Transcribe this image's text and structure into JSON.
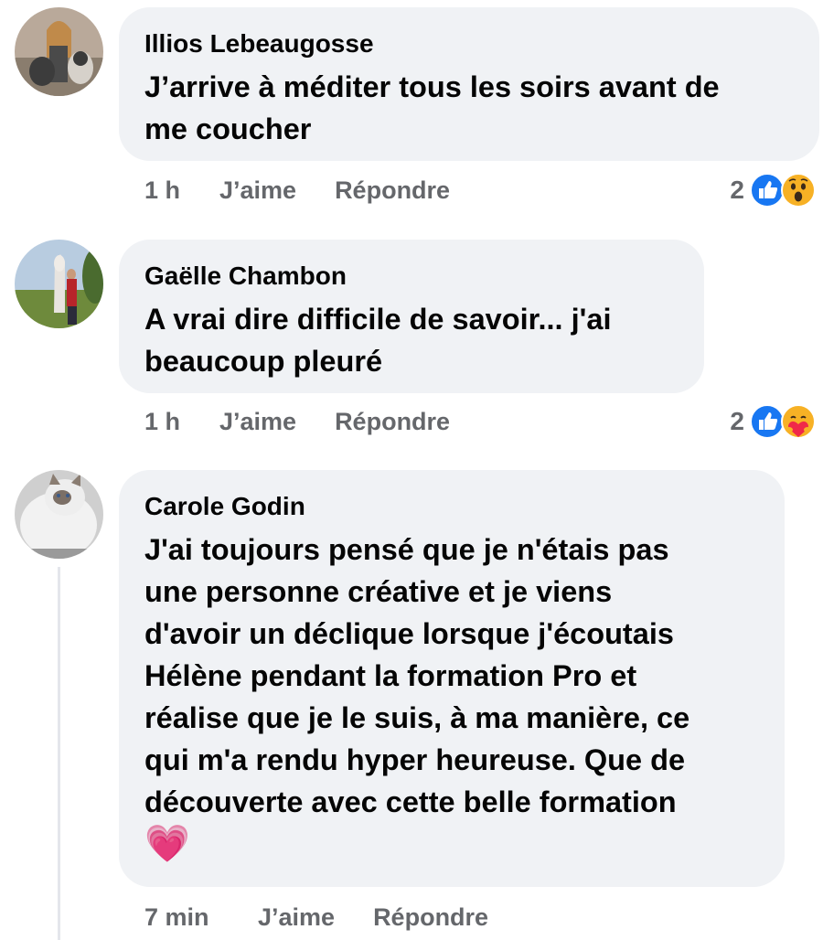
{
  "comments": [
    {
      "author": "Illios Lebeaugosse",
      "lines": [
        "J’arrive à méditer tous les soirs avant de",
        "me coucher"
      ],
      "time": "1 h",
      "like_label": "J’aime",
      "reply_label": "Répondre",
      "reaction_count": "2",
      "reactions": [
        "like-icon",
        "wow-icon"
      ]
    },
    {
      "author": "Gaëlle Chambon",
      "lines": [
        "A vrai dire difficile de savoir... j'ai",
        "beaucoup pleuré"
      ],
      "time": "1 h",
      "like_label": "J’aime",
      "reply_label": "Répondre",
      "reaction_count": "2",
      "reactions": [
        "like-icon",
        "care-icon"
      ]
    },
    {
      "author": "Carole Godin",
      "lines": [
        "J'ai toujours pensé que je n'étais pas",
        "une personne créative et je  viens",
        "d'avoir un déclique lorsque j'écoutais",
        "Hélène pendant la formation Pro et",
        "réalise que je le suis, à ma manière, ce",
        "qui m'a rendu hyper heureuse. Que de",
        "découverte avec cette belle formation"
      ],
      "emoji": "💗",
      "time": "7 min",
      "like_label": "J’aime",
      "reply_label": "Répondre"
    }
  ],
  "colors": {
    "bubble": "#f0f2f5",
    "meta_text": "#65676b",
    "like_blue": "#1877f2",
    "wow_yellow": "#f7b125"
  }
}
